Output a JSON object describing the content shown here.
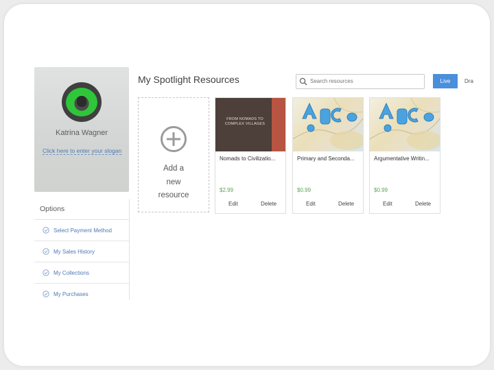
{
  "profile": {
    "name": "Katrina Wagner",
    "link_text": "Click here to enter your slogan"
  },
  "options": {
    "heading": "Options",
    "items": [
      {
        "label": "Select Payment Method",
        "icon": "check-circle-icon"
      },
      {
        "label": "My Sales History",
        "icon": "check-circle-icon"
      },
      {
        "label": "My Collections",
        "icon": "check-circle-icon"
      },
      {
        "label": "My Purchases",
        "icon": "check-circle-icon"
      }
    ]
  },
  "main": {
    "title": "My Spotlight Resources",
    "search_placeholder": "Search resources",
    "tabs": [
      "Live",
      "Dra"
    ],
    "add_resource_label": "Add a\nnew\nresource"
  },
  "resources": [
    {
      "title": "Nomads to Civilizatio...",
      "price": "$2.99",
      "edit": "Edit",
      "delete": "Delete",
      "cover_text": "FROM NOMADS TO COMPLEX VILLAGES"
    },
    {
      "title": "Primary and Seconda...",
      "price": "$0.99",
      "edit": "Edit",
      "delete": "Delete"
    },
    {
      "title": "Argumentative Writin...",
      "price": "$0.99",
      "edit": "Edit",
      "delete": "Delete"
    }
  ],
  "colors": {
    "accent_blue": "#4a8fdb",
    "link_blue": "#4f78b5",
    "price_green": "#5aa55a"
  }
}
